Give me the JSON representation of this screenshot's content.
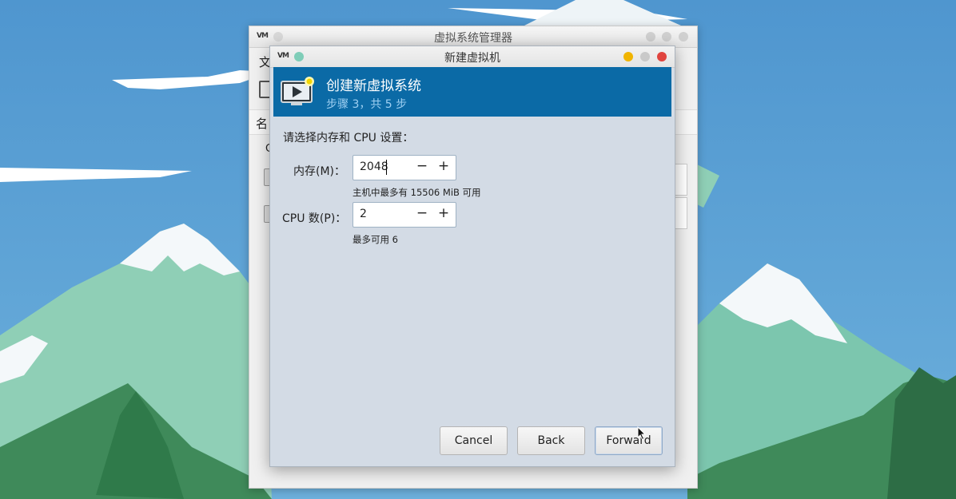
{
  "main_window": {
    "title": "虚拟系统管理器",
    "menu_first": "文",
    "column_header": "名",
    "row_letter": "C"
  },
  "dialog": {
    "title": "新建虚拟机",
    "banner_title": "创建新虚拟系统",
    "banner_step": "步骤 3，共 5 步",
    "instruction": "请选择内存和 CPU 设置：",
    "memory": {
      "label": "内存(M)：",
      "value": "2048",
      "hint": "主机中最多有 15506 MiB 可用"
    },
    "cpu": {
      "label": "CPU 数(P)：",
      "value": "2",
      "hint": "最多可用 6"
    },
    "minus": "−",
    "plus": "+",
    "buttons": {
      "cancel": "Cancel",
      "back": "Back",
      "forward": "Forward"
    }
  },
  "colors": {
    "banner": "#0b6aa6",
    "banner_subtitle": "#9fd0f2",
    "close_red": "#e0443e",
    "minimize_yellow": "#f0b400",
    "sky": "#5b9fd2"
  }
}
